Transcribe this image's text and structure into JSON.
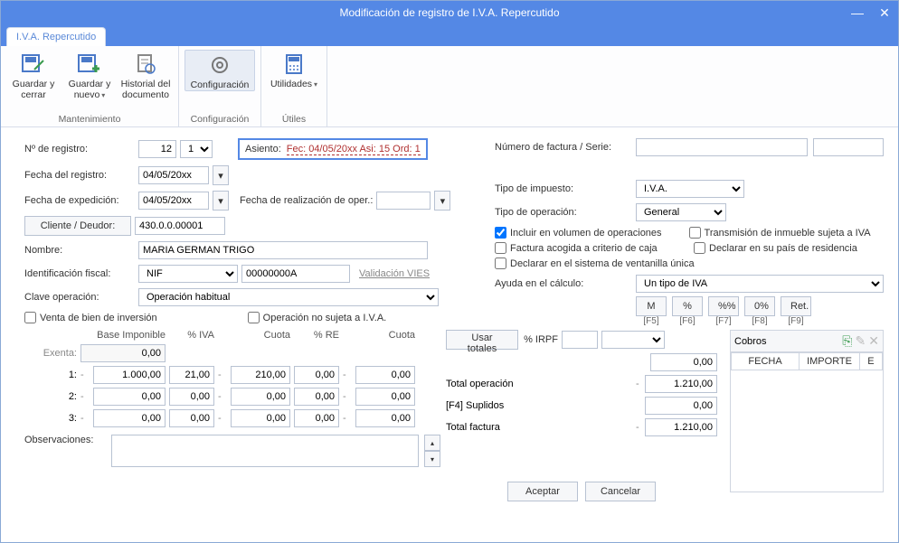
{
  "window": {
    "title": "Modificación de registro de I.V.A. Repercutido",
    "tab": "I.V.A. Repercutido"
  },
  "ribbon": {
    "guardar_cerrar": "Guardar y cerrar",
    "guardar_nuevo": "Guardar y nuevo",
    "historial": "Historial del documento",
    "config": "Configuración",
    "util": "Utilidades",
    "grp_mant": "Mantenimiento",
    "grp_conf": "Configuración",
    "grp_util": "Útiles"
  },
  "left": {
    "nreg_lbl": "Nº de registro:",
    "nreg_v1": "12",
    "nreg_v2": "1",
    "asiento_lbl": "Asiento:",
    "asiento_val": "Fec: 04/05/20xx Asi: 15 Ord: 1",
    "fecha_reg_lbl": "Fecha del registro:",
    "fecha_reg": "04/05/20xx",
    "fecha_exp_lbl": "Fecha de expedición:",
    "fecha_exp": "04/05/20xx",
    "fecha_oper_lbl": "Fecha de realización de oper.:",
    "fecha_oper": "",
    "cliente_btn": "Cliente / Deudor:",
    "cuenta": "430.0.0.00001",
    "nombre_lbl": "Nombre:",
    "nombre": "MARIA GERMAN TRIGO",
    "id_fiscal_lbl": "Identificación fiscal:",
    "id_tipo": "NIF",
    "id_num": "00000000A",
    "vies": "Validación VIES",
    "clave_lbl": "Clave operación:",
    "clave": "Operación habitual",
    "chk_venta": "Venta de bien de inversión",
    "chk_nosujeta": "Operación no sujeta a I.V.A."
  },
  "right": {
    "numfact_lbl": "Número de factura / Serie:",
    "tipo_imp_lbl": "Tipo de impuesto:",
    "tipo_imp": "I.V.A.",
    "tipo_op_lbl": "Tipo de operación:",
    "tipo_op": "General",
    "chk_volumen": "Incluir en volumen de operaciones",
    "chk_trans": "Transmisión de inmueble sujeta a IVA",
    "chk_caja": "Factura acogida a criterio de caja",
    "chk_pais": "Declarar en su país de residencia",
    "chk_ventunica": "Declarar en el sistema de ventanilla única",
    "ayuda_lbl": "Ayuda en el cálculo:",
    "ayuda": "Un tipo de IVA",
    "b_M": "M",
    "b_pct": "%",
    "b_pctpct": "%%",
    "b_0pct": "0%",
    "b_ret": "Ret.",
    "f5": "[F5]",
    "f6": "[F6]",
    "f7": "[F7]",
    "f8": "[F8]",
    "f9": "[F9]"
  },
  "grid": {
    "h_base": "Base Imponible",
    "h_pctiva": "% IVA",
    "h_cuota": "Cuota",
    "h_pctre": "% RE",
    "h_cuota2": "Cuota",
    "h_usar": "Usar totales",
    "h_irpf": "% IRPF",
    "rows": {
      "exenta": {
        "lbl": "Exenta:",
        "base": "0,00"
      },
      "r1": {
        "lbl": "1:",
        "sgn": "-",
        "base": "1.000,00",
        "piva": "21,00",
        "csgn": "-",
        "cuota": "210,00",
        "pre": "0,00",
        "c2sgn": "-",
        "cuota2": "0,00"
      },
      "r2": {
        "lbl": "2:",
        "sgn": "-",
        "base": "0,00",
        "piva": "0,00",
        "csgn": "-",
        "cuota": "0,00",
        "pre": "0,00",
        "c2sgn": "-",
        "cuota2": "0,00"
      },
      "r3": {
        "lbl": "3:",
        "sgn": "-",
        "base": "0,00",
        "piva": "0,00",
        "csgn": "-",
        "cuota": "0,00",
        "pre": "0,00",
        "c2sgn": "-",
        "cuota2": "0,00"
      }
    },
    "irpf_val": "0,00",
    "tot_op_lbl": "Total operación",
    "tot_op_sgn": "-",
    "tot_op": "1.210,00",
    "supl_lbl": "[F4] Suplidos",
    "supl": "0,00",
    "tot_fac_lbl": "Total factura",
    "tot_fac_sgn": "-",
    "tot_fac": "1.210,00",
    "obs_lbl": "Observaciones:"
  },
  "cobros": {
    "title": "Cobros",
    "col_fecha": "FECHA",
    "col_importe": "IMPORTE",
    "col_e": "E"
  },
  "footer": {
    "aceptar": "Aceptar",
    "cancelar": "Cancelar"
  }
}
